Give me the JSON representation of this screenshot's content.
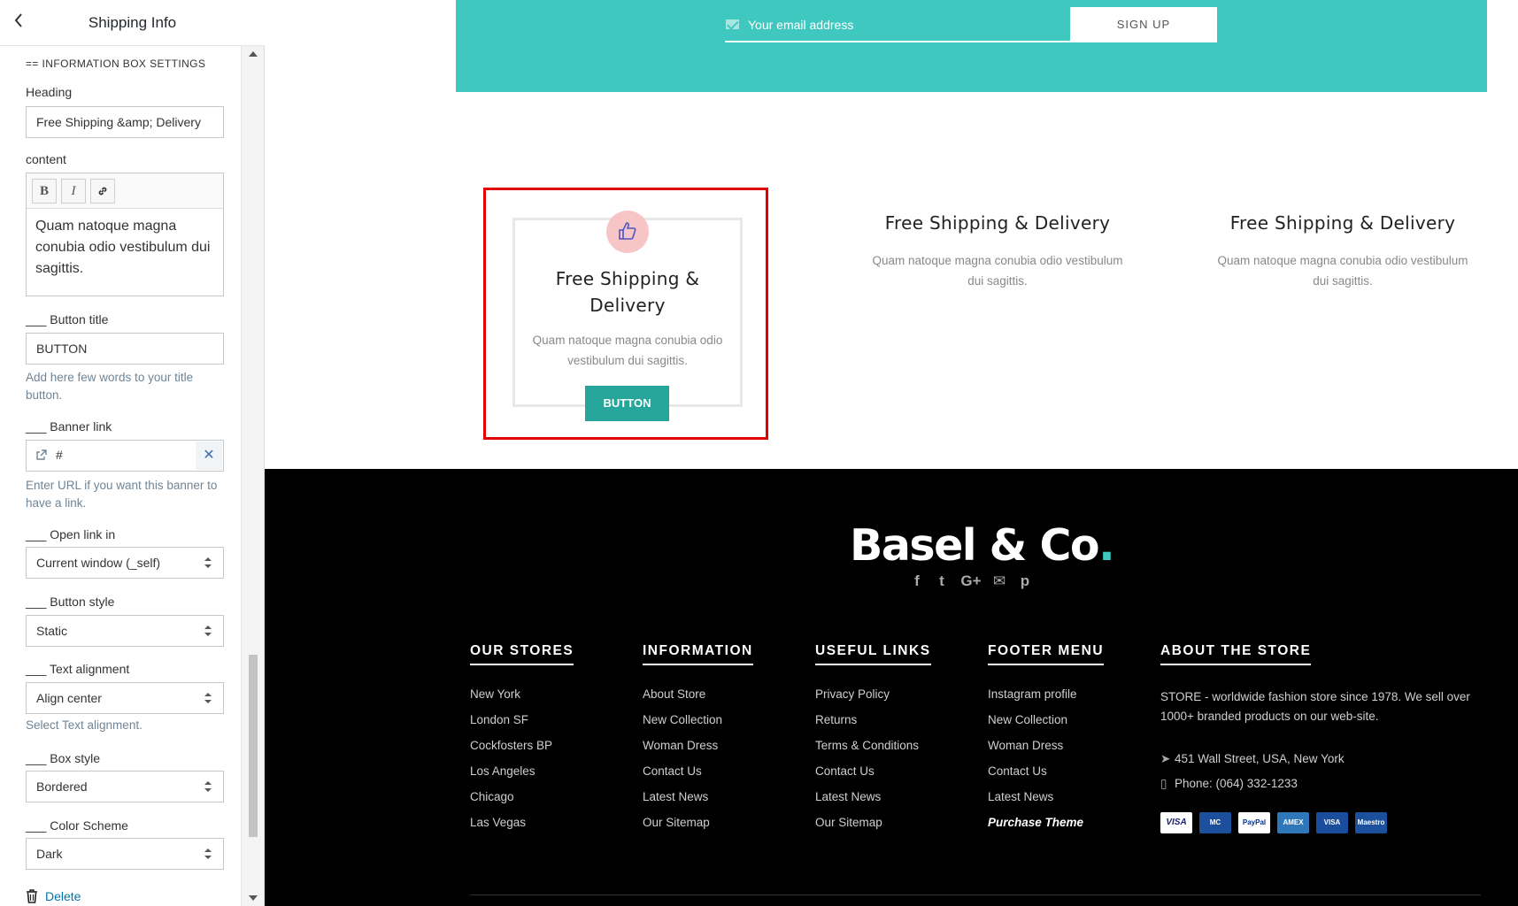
{
  "sidebar": {
    "back_icon": "chevron-left-icon",
    "title": "Shipping Info",
    "section_heading": "== INFORMATION BOX SETTINGS",
    "heading_label": "Heading",
    "heading_value": "Free Shipping &amp; Delivery",
    "content_label": "content",
    "editor_bold": "B",
    "editor_italic": "I",
    "editor_text": "Quam natoque magna conubia odio vestibulum dui sagittis.",
    "button_title_label": "___ Button title",
    "button_title_value": "BUTTON",
    "button_title_help": "Add here few words to your title button.",
    "banner_link_label": "___ Banner link",
    "banner_link_value": "#",
    "banner_link_clear": "✕",
    "banner_link_help": "Enter URL if you want this banner to have a link.",
    "open_link_label": "___ Open link in",
    "open_link_value": "Current window (_self)",
    "button_style_label": "___ Button style",
    "button_style_value": "Static",
    "text_alignment_label": "___ Text alignment",
    "text_alignment_value": "Align center",
    "text_alignment_help": "Select Text alignment.",
    "box_style_label": "___ Box style",
    "box_style_value": "Bordered",
    "color_scheme_label": "___ Color Scheme",
    "color_scheme_value": "Dark",
    "delete_label": "Delete"
  },
  "newsletter": {
    "email_placeholder": "Your email address",
    "signup_label": "SIGN UP",
    "bg_color": "#3ec8bf"
  },
  "features": [
    {
      "heading": "Free Shipping & Delivery",
      "text": "Quam natoque magna conubia odio vestibulum dui sagittis.",
      "button": "BUTTON",
      "icon": "thumbs-up-icon"
    },
    {
      "heading": "Free Shipping & Delivery",
      "text": "Quam natoque magna conubia odio vestibulum dui sagittis."
    },
    {
      "heading": "Free Shipping & Delivery",
      "text": "Quam natoque magna conubia odio vestibulum dui sagittis."
    }
  ],
  "footer": {
    "logo_text": "Basel & Co",
    "logo_dot": ".",
    "socials": {
      "facebook": "f",
      "twitter": "t",
      "google": "G+",
      "email": "✉",
      "pinterest": "p"
    },
    "columns": [
      {
        "title": "OUR STORES",
        "links": [
          "New York",
          "London SF",
          "Cockfosters BP",
          "Los Angeles",
          "Chicago",
          "Las Vegas"
        ]
      },
      {
        "title": "INFORMATION",
        "links": [
          "About Store",
          "New Collection",
          "Woman Dress",
          "Contact Us",
          "Latest News",
          "Our Sitemap"
        ]
      },
      {
        "title": "USEFUL LINKS",
        "links": [
          "Privacy Policy",
          "Returns",
          "Terms & Conditions",
          "Contact Us",
          "Latest News",
          "Our Sitemap"
        ]
      },
      {
        "title": "FOOTER MENU",
        "links": [
          "Instagram profile",
          "New Collection",
          "Woman Dress",
          "Contact Us",
          "Latest News",
          "Purchase Theme"
        ]
      }
    ],
    "about": {
      "title": "ABOUT THE STORE",
      "text": "STORE - worldwide fashion store since 1978. We sell over 1000+ branded products on our web-site.",
      "address": "451 Wall Street, USA, New York",
      "phone": "Phone: (064) 332-1233",
      "cards": [
        "VISA",
        "MC",
        "PayPal",
        "AMEX",
        "VISA",
        "Maestro"
      ]
    }
  }
}
